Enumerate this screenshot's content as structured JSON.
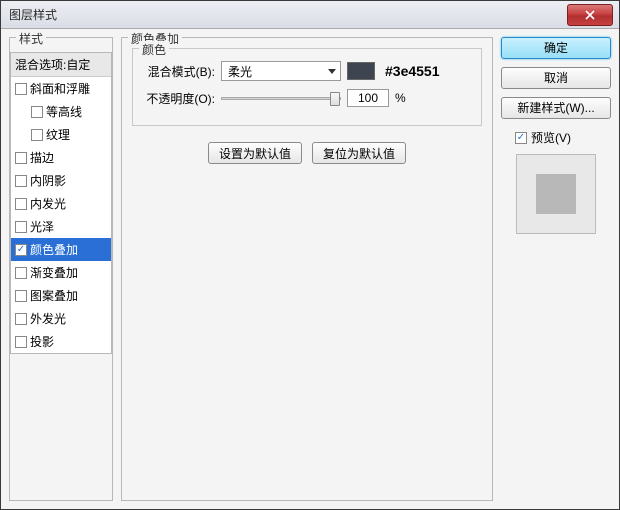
{
  "window": {
    "title": "图层样式"
  },
  "sidebar": {
    "header": "样式",
    "blend_options": "混合选项:自定",
    "items": [
      {
        "label": "斜面和浮雕",
        "checked": false,
        "indent": false
      },
      {
        "label": "等高线",
        "checked": false,
        "indent": true
      },
      {
        "label": "纹理",
        "checked": false,
        "indent": true
      },
      {
        "label": "描边",
        "checked": false,
        "indent": false
      },
      {
        "label": "内阴影",
        "checked": false,
        "indent": false
      },
      {
        "label": "内发光",
        "checked": false,
        "indent": false
      },
      {
        "label": "光泽",
        "checked": false,
        "indent": false
      },
      {
        "label": "颜色叠加",
        "checked": true,
        "indent": false,
        "selected": true
      },
      {
        "label": "渐变叠加",
        "checked": false,
        "indent": false
      },
      {
        "label": "图案叠加",
        "checked": false,
        "indent": false
      },
      {
        "label": "外发光",
        "checked": false,
        "indent": false
      },
      {
        "label": "投影",
        "checked": false,
        "indent": false
      }
    ]
  },
  "main": {
    "group_title": "颜色叠加",
    "sub_title": "颜色",
    "blend_mode_label": "混合模式(B):",
    "blend_mode_value": "柔光",
    "color_hex": "#3e4551",
    "opacity_label": "不透明度(O):",
    "opacity_value": "100",
    "opacity_unit": "%",
    "btn_set_default": "设置为默认值",
    "btn_reset_default": "复位为默认值"
  },
  "actions": {
    "ok": "确定",
    "cancel": "取消",
    "new_style": "新建样式(W)...",
    "preview_label": "预览(V)",
    "preview_checked": true
  }
}
